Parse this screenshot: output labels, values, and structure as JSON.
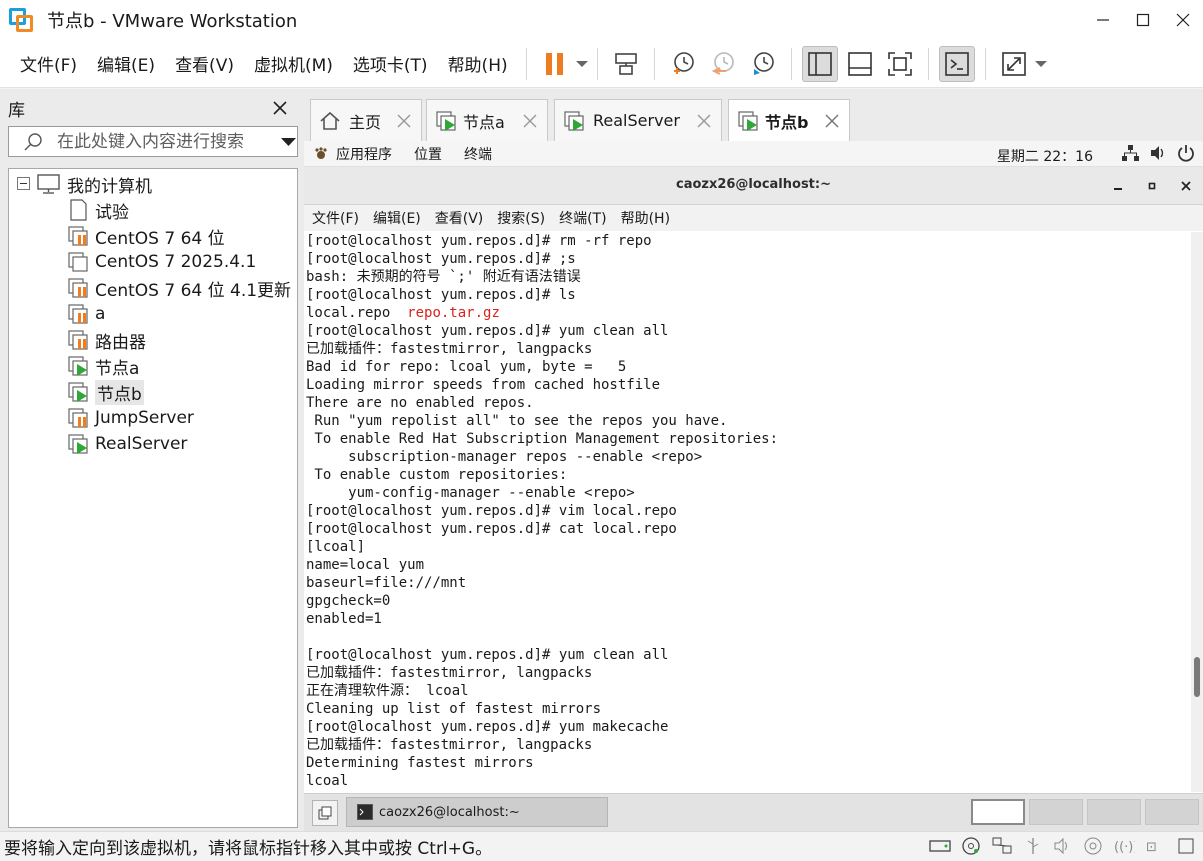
{
  "window": {
    "title": "节点b - VMware Workstation"
  },
  "menubar": {
    "items": [
      "文件(F)",
      "编辑(E)",
      "查看(V)",
      "虚拟机(M)",
      "选项卡(T)",
      "帮助(H)"
    ]
  },
  "toolbar": {
    "icons": [
      "pause-icon",
      "send-keys-icon",
      "snapshot-take-icon",
      "snapshot-revert-icon",
      "snapshot-manager-icon",
      "library-view-icon",
      "thumbnail-view-icon",
      "fullscreen-icon",
      "console-view-icon",
      "stretch-icon"
    ],
    "accent": "#f07c22"
  },
  "library": {
    "title": "库",
    "search_placeholder": "在此处键入内容进行搜索",
    "root": "我的计算机",
    "items": [
      {
        "label": "试验",
        "icon": "vm-blank-icon"
      },
      {
        "label": "CentOS 7 64 位",
        "icon": "vm-paused-icon"
      },
      {
        "label": "CentOS 7 2025.4.1",
        "icon": "vm-clone-icon"
      },
      {
        "label": "CentOS 7 64 位 4.1更新",
        "icon": "vm-paused-icon"
      },
      {
        "label": "a",
        "icon": "vm-paused-icon"
      },
      {
        "label": "路由器",
        "icon": "vm-paused-icon"
      },
      {
        "label": "节点a",
        "icon": "vm-running-icon"
      },
      {
        "label": "节点b",
        "icon": "vm-running-icon"
      },
      {
        "label": "JumpServer",
        "icon": "vm-paused-icon"
      },
      {
        "label": "RealServer",
        "icon": "vm-running-icon"
      }
    ]
  },
  "tabs": [
    {
      "label": "主页",
      "icon": "home-icon"
    },
    {
      "label": "节点a",
      "icon": "vm-running-icon"
    },
    {
      "label": "RealServer",
      "icon": "vm-running-icon"
    },
    {
      "label": "节点b",
      "icon": "vm-running-icon"
    }
  ],
  "gnome": {
    "apps": "应用程序",
    "places": "位置",
    "terminal": "终端",
    "clock": "星期二 22：16"
  },
  "terminal": {
    "title": "caozx26@localhost:~",
    "menu": [
      "文件(F)",
      "编辑(E)",
      "查看(V)",
      "搜索(S)",
      "终端(T)",
      "帮助(H)"
    ],
    "lines": [
      "[root@localhost yum.repos.d]# rm -rf repo",
      "[root@localhost yum.repos.d]# ;s",
      "bash: 未预期的符号 `;' 附近有语法错误",
      "[root@localhost yum.repos.d]# ls",
      "local.repo  ",
      "[root@localhost yum.repos.d]# yum clean all",
      "已加载插件：fastestmirror, langpacks",
      "Bad id for repo: lcoal yum, byte =   5",
      "Loading mirror speeds from cached hostfile",
      "There are no enabled repos.",
      " Run \"yum repolist all\" to see the repos you have.",
      " To enable Red Hat Subscription Management repositories:",
      "     subscription-manager repos --enable <repo>",
      " To enable custom repositories:",
      "     yum-config-manager --enable <repo>",
      "[root@localhost yum.repos.d]# vim local.repo",
      "[root@localhost yum.repos.d]# cat local.repo",
      "[lcoal]",
      "name=local yum",
      "baseurl=file:///mnt",
      "gpgcheck=0",
      "enabled=1",
      "",
      "[root@localhost yum.repos.d]# yum clean all",
      "已加载插件：fastestmirror, langpacks",
      "正在清理软件源： lcoal",
      "Cleaning up list of fastest mirrors",
      "[root@localhost yum.repos.d]# yum makecache",
      "已加载插件：fastestmirror, langpacks",
      "Determining fastest mirrors",
      "lcoal"
    ],
    "ls_highlight": "repo.tar.gz",
    "highlight_color": "#d9231d"
  },
  "taskbar": {
    "task_label": "caozx26@localhost:~",
    "workspaces": 4
  },
  "statusbar": {
    "message": "要将输入定向到该虚拟机，请将鼠标指针移入其中或按 Ctrl+G。"
  }
}
